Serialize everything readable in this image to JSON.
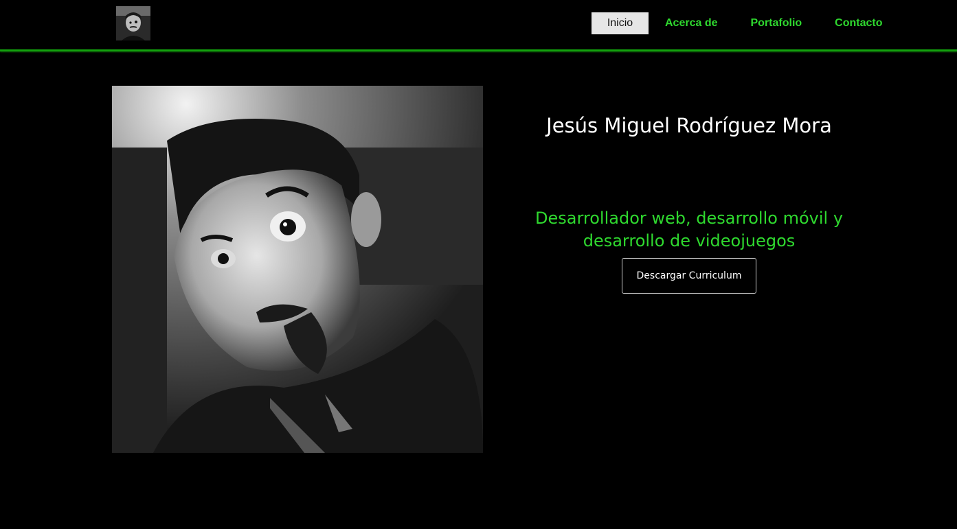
{
  "nav": {
    "logo_alt": "avatar",
    "items": [
      {
        "label": "Inicio",
        "active": true
      },
      {
        "label": "Acerca de",
        "active": false
      },
      {
        "label": "Portafolio",
        "active": false
      },
      {
        "label": "Contacto",
        "active": false
      }
    ]
  },
  "hero": {
    "name": "Jesús Miguel Rodríguez Mora",
    "role_line1": "Desarrollador web, desarrollo móvil y",
    "role_line2": "desarrollo de videojuegos",
    "cv_button_label": "Descargar Curriculum"
  },
  "colors": {
    "background": "#000000",
    "accent": "#2fd92f",
    "active_tab_bg": "#e6e6e6"
  }
}
